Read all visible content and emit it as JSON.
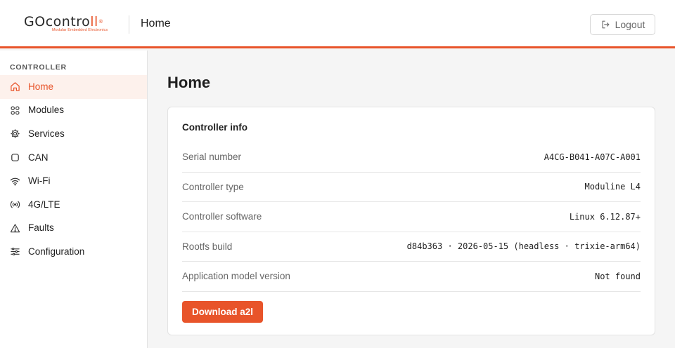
{
  "logo": {
    "brand_go": "GO",
    "brand_contro": "contro",
    "brand_ll": "ll",
    "reg_mark": "®",
    "tagline": "Modular Embedded Electronics"
  },
  "header": {
    "title": "Home",
    "logout_label": "Logout"
  },
  "sidebar": {
    "heading": "CONTROLLER",
    "items": [
      {
        "label": "Home",
        "icon": "home-icon",
        "active": true
      },
      {
        "label": "Modules",
        "icon": "grid-icon"
      },
      {
        "label": "Services",
        "icon": "gear-icon"
      },
      {
        "label": "CAN",
        "icon": "chip-icon"
      },
      {
        "label": "Wi-Fi",
        "icon": "wifi-icon"
      },
      {
        "label": "4G/LTE",
        "icon": "signal-icon"
      },
      {
        "label": "Faults",
        "icon": "warning-icon"
      },
      {
        "label": "Configuration",
        "icon": "sliders-icon"
      }
    ]
  },
  "main": {
    "page_title": "Home",
    "card": {
      "title": "Controller info",
      "rows": [
        {
          "label": "Serial number",
          "value": "A4CG-B041-A07C-A001"
        },
        {
          "label": "Controller type",
          "value": "Moduline L4"
        },
        {
          "label": "Controller software",
          "value": "Linux 6.12.87+"
        },
        {
          "label": "Rootfs build",
          "value": "d84b363 · 2026-05-15 (headless · trixie-arm64)"
        },
        {
          "label": "Application model version",
          "value": "Not found"
        }
      ],
      "download_label": "Download a2l"
    }
  },
  "colors": {
    "accent": "#e8542a",
    "active_bg": "#fdf1ec",
    "page_bg": "#f5f5f5"
  }
}
